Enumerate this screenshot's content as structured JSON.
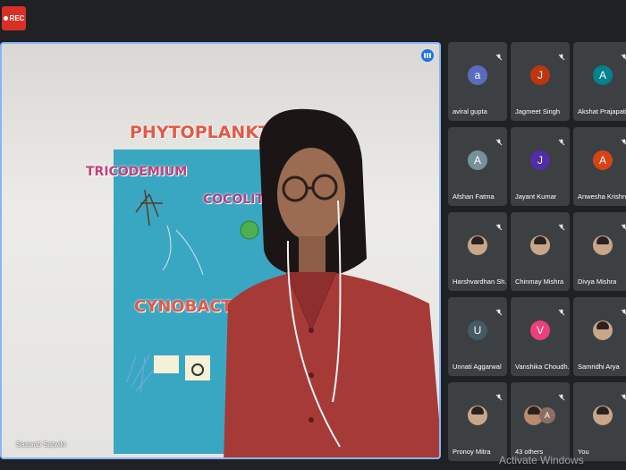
{
  "rec_label": "REC",
  "main": {
    "name": "Saswati Satwiki"
  },
  "poster": {
    "title": "PHYTOPLANKTON",
    "left": "TRICODEMIUM",
    "right": "COCOLITH",
    "center": "CYNOBACTERIA"
  },
  "participants": [
    {
      "name": "aviral gupta",
      "initial": "a",
      "color": "#5c6bc0"
    },
    {
      "name": "Jagmeet Singh",
      "initial": "J",
      "color": "#bf360c"
    },
    {
      "name": "Akshat Prajapati",
      "initial": "A",
      "color": "#00838f"
    },
    {
      "name": "Afshan Fatma",
      "initial": "A",
      "color": "#78909c"
    },
    {
      "name": "Jayant Kumar",
      "initial": "J",
      "color": "#512da8"
    },
    {
      "name": "Anwesha Krishna",
      "initial": "A",
      "color": "#d84315"
    },
    {
      "name": "Harshvardhan Sh...",
      "initial": "",
      "color": "photo"
    },
    {
      "name": "Chinmay Mishra",
      "initial": "",
      "color": "photo"
    },
    {
      "name": "Divya Mishra",
      "initial": "",
      "color": "photo"
    },
    {
      "name": "Unnati Aggarwal",
      "initial": "U",
      "color": "#455a64"
    },
    {
      "name": "Vanshika Choudh...",
      "initial": "V",
      "color": "#ec407a"
    },
    {
      "name": "Samridhi Arya",
      "initial": "",
      "color": "photo"
    },
    {
      "name": "Pronoy Mitra",
      "initial": "",
      "color": "photo"
    },
    {
      "name": "43 others",
      "initial": "",
      "color": "group"
    },
    {
      "name": "You",
      "initial": "",
      "color": "photo"
    }
  ],
  "watermark": "Activate Windows"
}
